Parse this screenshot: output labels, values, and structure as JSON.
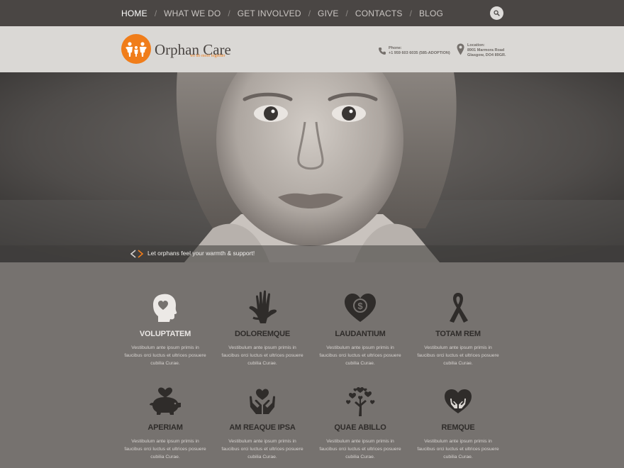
{
  "nav": {
    "items": [
      {
        "label": "HOME",
        "active": true
      },
      {
        "label": "WHAT WE DO"
      },
      {
        "label": "GET INVOLVED"
      },
      {
        "label": "GIVE"
      },
      {
        "label": "CONTACTS"
      },
      {
        "label": "BLOG"
      }
    ],
    "separator": "/",
    "search_icon": "search-icon"
  },
  "header": {
    "logo_name": "Orphan Care",
    "logo_tagline": "we do more together",
    "phone_label": "Phone:",
    "phone_value": "+1 959 603 6035 (585-ADOPTION)",
    "location_label": "Location:",
    "location_line1": "8901 Marmora Road",
    "location_line2": "Glasgow, DO4 89GR."
  },
  "hero": {
    "caption": "Let orphans feel your warmth & support!",
    "image": "black-and-white portrait of a girl"
  },
  "features": [
    {
      "title": "VOLUPTATEM",
      "icon": "head-heart-icon",
      "text": "Vestibulum ante ipsum primis in faucibus orci luctus et ultrices posuere cubilia Curae."
    },
    {
      "title": "DOLOREMQUE",
      "icon": "hands-icon",
      "text": "Vestibulum ante ipsum primis in faucibus orci luctus et ultrices posuere cubilia Curae."
    },
    {
      "title": "LAUDANTIUM",
      "icon": "heart-coin-icon",
      "text": "Vestibulum ante ipsum primis in faucibus orci luctus et ultrices posuere cubilia Curae."
    },
    {
      "title": "TOTAM REM",
      "icon": "ribbon-icon",
      "text": "Vestibulum ante ipsum primis in faucibus orci luctus et ultrices posuere cubilia Curae."
    },
    {
      "title": "APERIAM",
      "icon": "piggy-bank-icon",
      "text": "Vestibulum ante ipsum primis in faucibus orci luctus et ultrices posuere cubilia Curae."
    },
    {
      "title": "AM REAQUE IPSA",
      "icon": "hands-heart-icon",
      "text": "Vestibulum ante ipsum primis in faucibus orci luctus et ultrices posuere cubilia Curae."
    },
    {
      "title": "QUAE ABILLO",
      "icon": "heart-tree-icon",
      "text": "Vestibulum ante ipsum primis in faucibus orci luctus et ultrices posuere cubilia Curae."
    },
    {
      "title": "REMQUE",
      "icon": "heart-hands-icon",
      "text": "Vestibulum ante ipsum primis in faucibus orci luctus et ultrices posuere cubilia Curae."
    }
  ],
  "colors": {
    "accent": "#f07d1a",
    "nav_bg": "#4a4644",
    "header_bg": "#dad8d5",
    "features_bg": "#76726f"
  }
}
